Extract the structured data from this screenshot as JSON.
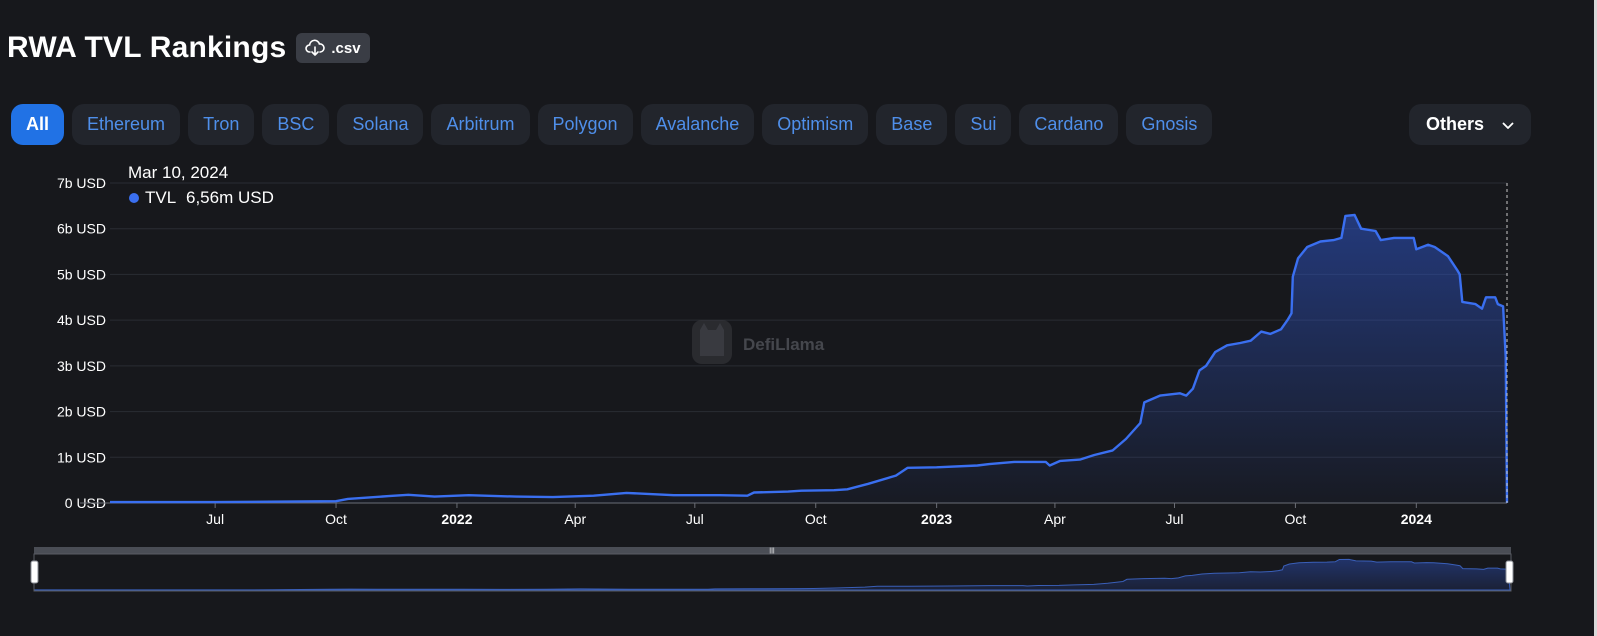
{
  "header": {
    "title": "RWA TVL Rankings",
    "csv_label": ".csv",
    "csv_icon": "cloud-download-icon"
  },
  "tabs": [
    {
      "label": "All",
      "active": true
    },
    {
      "label": "Ethereum",
      "active": false
    },
    {
      "label": "Tron",
      "active": false
    },
    {
      "label": "BSC",
      "active": false
    },
    {
      "label": "Solana",
      "active": false
    },
    {
      "label": "Arbitrum",
      "active": false
    },
    {
      "label": "Polygon",
      "active": false
    },
    {
      "label": "Avalanche",
      "active": false
    },
    {
      "label": "Optimism",
      "active": false
    },
    {
      "label": "Base",
      "active": false
    },
    {
      "label": "Sui",
      "active": false
    },
    {
      "label": "Cardano",
      "active": false
    },
    {
      "label": "Gnosis",
      "active": false
    }
  ],
  "others": {
    "label": "Others",
    "icon": "chevron-down-icon"
  },
  "tooltip": {
    "date": "Mar 10, 2024",
    "series": "TVL",
    "value": "6,56m USD"
  },
  "watermark": {
    "text": "DefiLlama"
  },
  "colors": {
    "background": "#17181c",
    "line": "#3a6ff0",
    "tab_active": "#2172e5",
    "tab_text": "#4f8fea",
    "tab_bg": "#22252c"
  },
  "chart_data": {
    "type": "area",
    "ylim": [
      0,
      7000000000
    ],
    "x_range": [
      "2021-04-12",
      "2024-03-10"
    ],
    "y_ticks": [
      "0 USD",
      "1b USD",
      "2b USD",
      "3b USD",
      "4b USD",
      "5b USD",
      "6b USD",
      "7b USD"
    ],
    "x_ticks": [
      {
        "label": "Jul",
        "date": "2021-07-01",
        "bold": false
      },
      {
        "label": "Oct",
        "date": "2021-10-01",
        "bold": false
      },
      {
        "label": "2022",
        "date": "2022-01-01",
        "bold": true
      },
      {
        "label": "Apr",
        "date": "2022-04-01",
        "bold": false
      },
      {
        "label": "Jul",
        "date": "2022-07-01",
        "bold": false
      },
      {
        "label": "Oct",
        "date": "2022-10-01",
        "bold": false
      },
      {
        "label": "2023",
        "date": "2023-01-01",
        "bold": true
      },
      {
        "label": "Apr",
        "date": "2023-04-01",
        "bold": false
      },
      {
        "label": "Jul",
        "date": "2023-07-01",
        "bold": false
      },
      {
        "label": "Oct",
        "date": "2023-10-01",
        "bold": false
      },
      {
        "label": "2024",
        "date": "2024-01-01",
        "bold": true
      }
    ],
    "grid": true,
    "series": [
      {
        "values": [
          [
            "2021-04-12",
            0.02
          ],
          [
            "2021-07-01",
            0.02
          ],
          [
            "2021-10-01",
            0.04
          ],
          [
            "2021-10-10",
            0.09
          ],
          [
            "2021-11-10",
            0.15
          ],
          [
            "2021-11-25",
            0.18
          ],
          [
            "2021-12-15",
            0.14
          ],
          [
            "2022-01-10",
            0.17
          ],
          [
            "2022-02-15",
            0.14
          ],
          [
            "2022-03-15",
            0.13
          ],
          [
            "2022-04-15",
            0.16
          ],
          [
            "2022-05-10",
            0.22
          ],
          [
            "2022-06-15",
            0.17
          ],
          [
            "2022-07-20",
            0.17
          ],
          [
            "2022-08-10",
            0.16
          ],
          [
            "2022-08-15",
            0.23
          ],
          [
            "2022-09-10",
            0.25
          ],
          [
            "2022-09-20",
            0.27
          ],
          [
            "2022-10-15",
            0.28
          ],
          [
            "2022-10-25",
            0.3
          ],
          [
            "2022-11-10",
            0.42
          ],
          [
            "2022-12-01",
            0.6
          ],
          [
            "2022-12-10",
            0.77
          ],
          [
            "2023-01-01",
            0.78
          ],
          [
            "2023-02-01",
            0.82
          ],
          [
            "2023-02-10",
            0.85
          ],
          [
            "2023-03-01",
            0.9
          ],
          [
            "2023-03-25",
            0.9
          ],
          [
            "2023-03-28",
            0.82
          ],
          [
            "2023-04-05",
            0.92
          ],
          [
            "2023-04-20",
            0.95
          ],
          [
            "2023-05-01",
            1.05
          ],
          [
            "2023-05-15",
            1.15
          ],
          [
            "2023-05-25",
            1.4
          ],
          [
            "2023-06-05",
            1.75
          ],
          [
            "2023-06-08",
            2.2
          ],
          [
            "2023-06-20",
            2.35
          ],
          [
            "2023-07-05",
            2.4
          ],
          [
            "2023-07-10",
            2.35
          ],
          [
            "2023-07-15",
            2.5
          ],
          [
            "2023-07-20",
            2.9
          ],
          [
            "2023-07-25",
            3.0
          ],
          [
            "2023-08-01",
            3.3
          ],
          [
            "2023-08-10",
            3.45
          ],
          [
            "2023-08-20",
            3.5
          ],
          [
            "2023-08-28",
            3.55
          ],
          [
            "2023-09-05",
            3.75
          ],
          [
            "2023-09-12",
            3.7
          ],
          [
            "2023-09-20",
            3.8
          ],
          [
            "2023-09-25",
            4.0
          ],
          [
            "2023-09-28",
            4.15
          ],
          [
            "2023-09-29",
            4.95
          ],
          [
            "2023-10-03",
            5.35
          ],
          [
            "2023-10-10",
            5.6
          ],
          [
            "2023-10-20",
            5.72
          ],
          [
            "2023-10-30",
            5.75
          ],
          [
            "2023-11-05",
            5.8
          ],
          [
            "2023-11-08",
            6.28
          ],
          [
            "2023-11-15",
            6.3
          ],
          [
            "2023-11-20",
            6.0
          ],
          [
            "2023-12-01",
            5.95
          ],
          [
            "2023-12-05",
            5.75
          ],
          [
            "2023-12-15",
            5.8
          ],
          [
            "2023-12-30",
            5.8
          ],
          [
            "2024-01-01",
            5.55
          ],
          [
            "2024-01-10",
            5.65
          ],
          [
            "2024-01-15",
            5.6
          ],
          [
            "2024-01-25",
            5.4
          ],
          [
            "2024-02-01",
            5.1
          ],
          [
            "2024-02-03",
            5.0
          ],
          [
            "2024-02-05",
            4.4
          ],
          [
            "2024-02-15",
            4.35
          ],
          [
            "2024-02-20",
            4.25
          ],
          [
            "2024-02-23",
            4.5
          ],
          [
            "2024-03-01",
            4.5
          ],
          [
            "2024-03-03",
            4.35
          ],
          [
            "2024-03-07",
            4.3
          ],
          [
            "2024-03-09",
            3.2
          ],
          [
            "2024-03-10",
            0.0066
          ]
        ],
        "unit": "b USD"
      }
    ]
  }
}
